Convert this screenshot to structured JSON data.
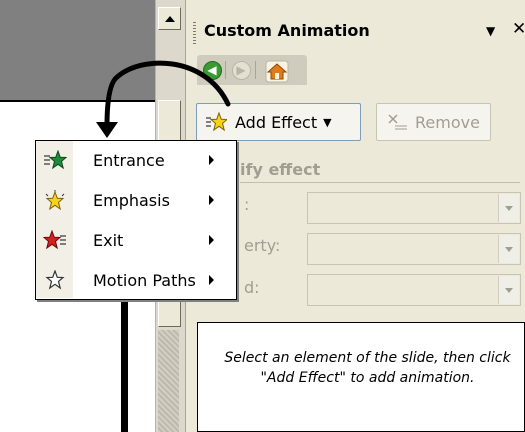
{
  "task_pane": {
    "title": "Custom Animation",
    "dropdown_icon": "▼",
    "close_icon": "✕",
    "nav": {
      "back_icon": "back-arrow-icon",
      "forward_icon": "forward-arrow-icon",
      "home_icon": "home-icon"
    },
    "add_effect_label": "Add Effect",
    "remove_label": "Remove",
    "modify_heading": "ify effect",
    "start_label": ":",
    "property_label": "erty:",
    "speed_label": "d:",
    "list_hint": "Select an element of the slide, then click \"Add Effect\" to add animation."
  },
  "menu": {
    "items": [
      {
        "label": "Entrance",
        "icon": "entrance-star-icon",
        "color": "#1f8a3a"
      },
      {
        "label": "Emphasis",
        "icon": "emphasis-star-icon",
        "color": "#f2c400"
      },
      {
        "label": "Exit",
        "icon": "exit-star-icon",
        "color": "#d42020"
      },
      {
        "label": "Motion Paths",
        "icon": "motion-path-star-icon",
        "color": "#ffffff"
      }
    ]
  },
  "colors": {
    "pane_background": "#ece9d8",
    "slide_gray": "#808080",
    "disabled_text": "#a19e91"
  }
}
